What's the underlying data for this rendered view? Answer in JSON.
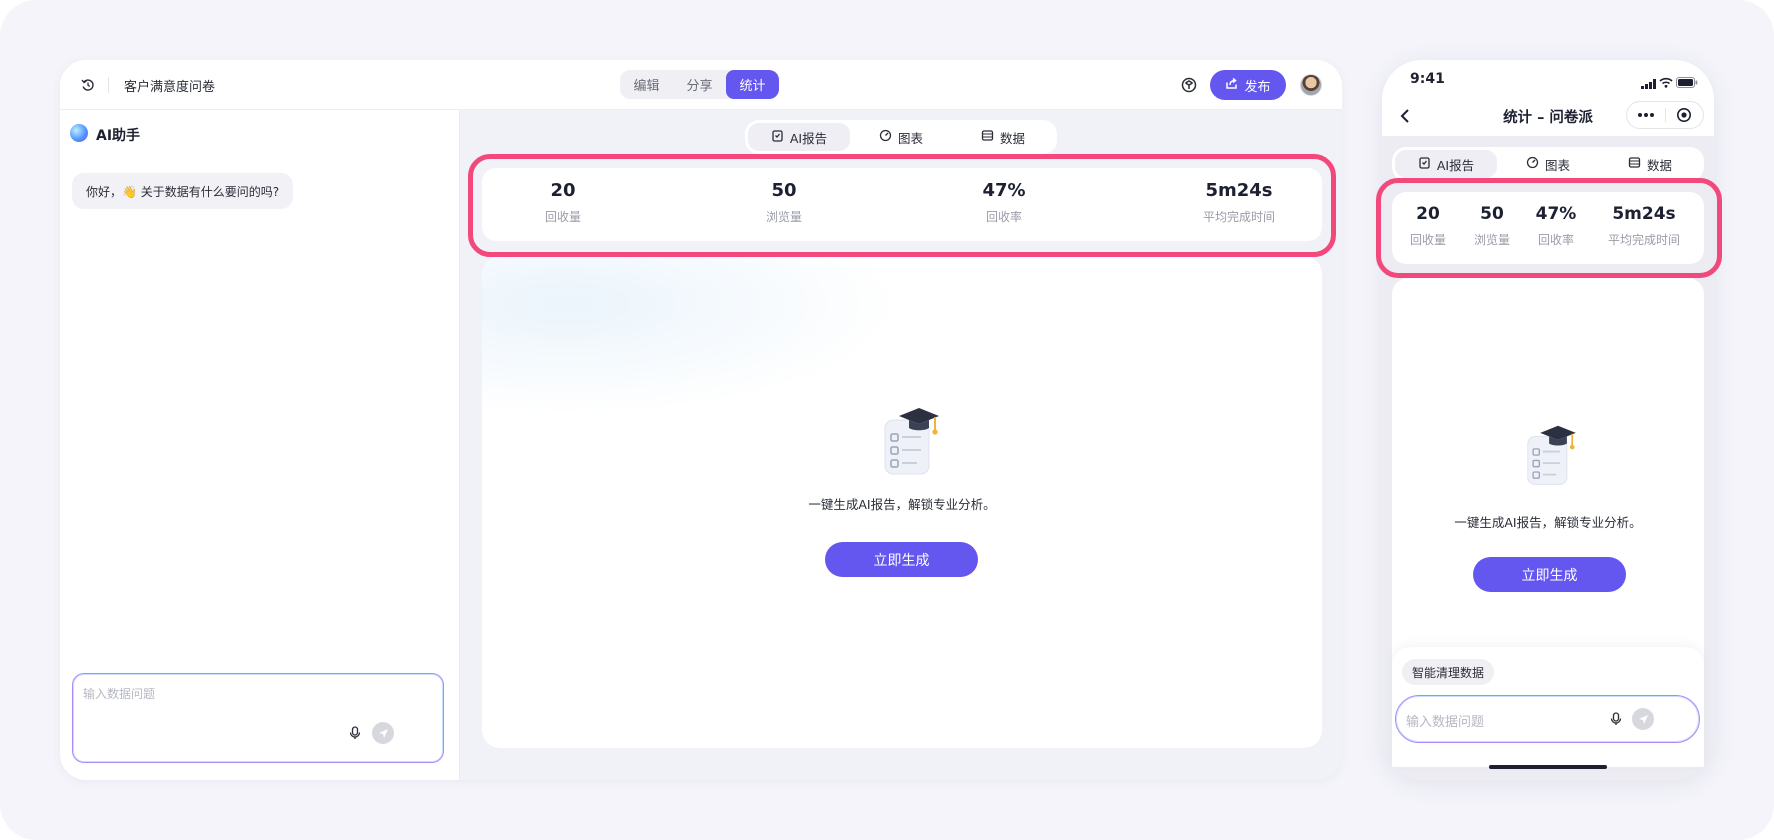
{
  "desktop": {
    "doc_title": "客户满意度问卷",
    "mode_tabs": [
      {
        "label": "编辑",
        "active": false
      },
      {
        "label": "分享",
        "active": false
      },
      {
        "label": "统计",
        "active": true
      }
    ],
    "publish_label": "发布",
    "assistant": {
      "title": "AI助手",
      "greeting": "你好，👋 关于数据有什么要问的吗?",
      "input_placeholder": "输入数据问题"
    },
    "view_tabs": [
      {
        "label": "AI报告",
        "icon": "report-icon",
        "active": true
      },
      {
        "label": "图表",
        "icon": "gauge-icon",
        "active": false
      },
      {
        "label": "数据",
        "icon": "table-icon",
        "active": false
      }
    ],
    "stats": [
      {
        "value": "20",
        "label": "回收量"
      },
      {
        "value": "50",
        "label": "浏览量"
      },
      {
        "value": "47%",
        "label": "回收率"
      },
      {
        "value": "5m24s",
        "label": "平均完成时间"
      }
    ],
    "report": {
      "hint": "一键生成AI报告，解锁专业分析。",
      "generate_label": "立即生成"
    }
  },
  "phone": {
    "time": "9:41",
    "title": "统计 – 问卷派",
    "view_tabs": [
      {
        "label": "AI报告",
        "icon": "report-icon",
        "active": true
      },
      {
        "label": "图表",
        "icon": "gauge-icon",
        "active": false
      },
      {
        "label": "数据",
        "icon": "table-icon",
        "active": false
      }
    ],
    "stats": [
      {
        "value": "20",
        "label": "回收量"
      },
      {
        "value": "50",
        "label": "浏览量"
      },
      {
        "value": "47%",
        "label": "回收率"
      },
      {
        "value": "5m24s",
        "label": "平均完成时间"
      }
    ],
    "report": {
      "hint": "一键生成AI报告，解锁专业分析。",
      "generate_label": "立即生成"
    },
    "chip_label": "智能清理数据",
    "input_placeholder": "输入数据问题"
  },
  "colors": {
    "accent": "#6457f0",
    "highlight": "#f2487c",
    "background": "#f4f4fa"
  }
}
